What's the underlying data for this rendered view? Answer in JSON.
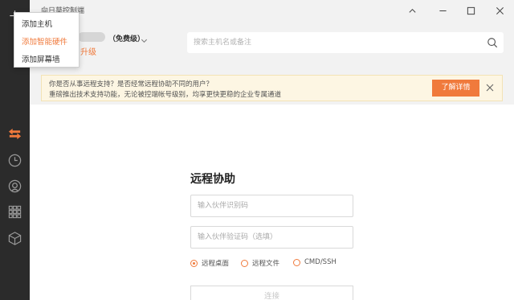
{
  "titlebar": {
    "title": "向日葵控制端"
  },
  "menu": {
    "items": [
      {
        "label": "添加主机"
      },
      {
        "label": "添加智能硬件"
      },
      {
        "label": "添加屏幕墙"
      }
    ]
  },
  "account": {
    "plan": "（免费级）",
    "upgrade": "升级"
  },
  "search": {
    "placeholder": "搜索主机名或备注"
  },
  "notice": {
    "line1": "你是否从事远程支持？是否经常远程协助不同的用户？",
    "line2": "重磅推出技术支持功能，无论被控端帐号级别，均享更快更稳的企业专属通道",
    "more_label": "了解详情"
  },
  "remote": {
    "title": "远程协助",
    "partner_id_placeholder": "输入伙伴识别码",
    "partner_code_placeholder": "输入伙伴验证码（选填）",
    "options": [
      {
        "label": "远程桌面",
        "selected": true
      },
      {
        "label": "远程文件",
        "selected": false
      },
      {
        "label": "CMD/SSH",
        "selected": false
      }
    ],
    "connect_label": "连接"
  },
  "colors": {
    "accent": "#f07a3c",
    "sidebar": "#2b2b2b",
    "notice_bg": "#fdf6e3"
  },
  "icons": {
    "sidebar": [
      "plus-icon",
      "remote-control-icon",
      "history-icon",
      "discover-icon",
      "apps-grid-icon",
      "hardware-box-icon"
    ],
    "window": [
      "collapse-icon",
      "minimize-icon",
      "maximize-icon",
      "close-icon"
    ]
  }
}
